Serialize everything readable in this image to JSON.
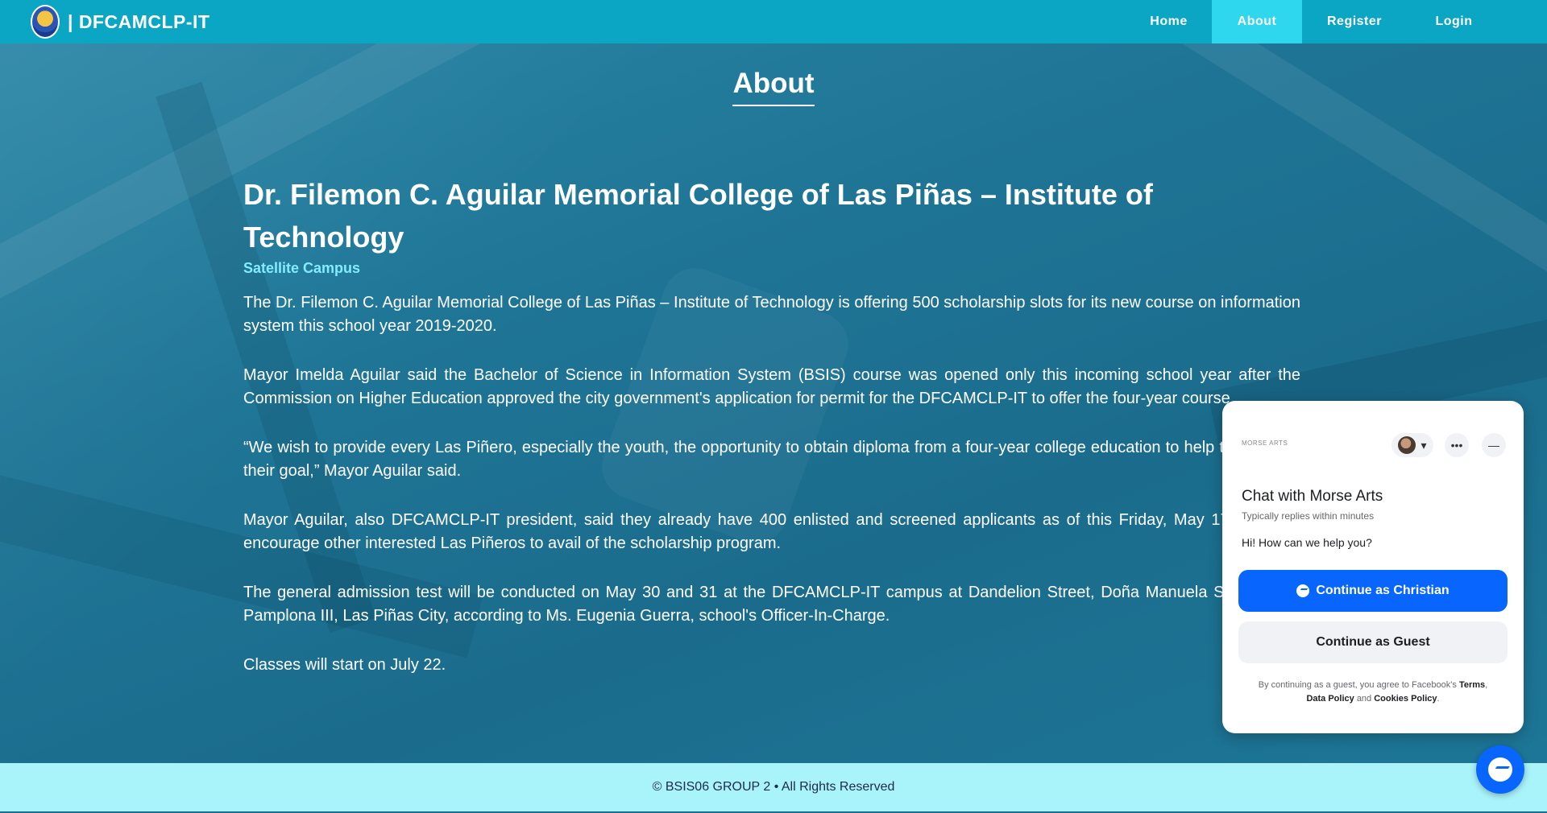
{
  "header": {
    "brand": "| DFCAMCLP-IT",
    "nav": [
      "Home",
      "About",
      "Register",
      "Login"
    ],
    "active": "About"
  },
  "page": {
    "title": "About",
    "college": "Dr. Filemon C. Aguilar Memorial College of Las Piñas – Institute of Technology",
    "campus": "Satellite Campus",
    "paragraphs": [
      "The Dr. Filemon C. Aguilar Memorial College of Las Piñas – Institute of Technology is offering 500 scholarship slots for its new course on information system this school year 2019-2020.",
      "Mayor Imelda Aguilar said the Bachelor of Science in Information System (BSIS) course was opened only this incoming school year after the Commission on Higher Education approved the city government's application for permit for the DFCAMCLP-IT to offer the four-year course.",
      "“We wish to provide every Las Piñero, especially the youth, the opportunity to obtain diploma from a four-year college education to help them reach their goal,” Mayor Aguilar said.",
      "Mayor Aguilar, also DFCAMCLP-IT president, said they already have 400 enlisted and screened applicants as of this Friday, May 17, and she encourage other interested Las Piñeros to avail of the scholarship program.",
      "The general admission test will be conducted on May 30 and 31 at the DFCAMCLP-IT campus at Dandelion Street, Doña Manuela Subdivision, Pamplona III, Las Piñas City, according to Ms. Eugenia Guerra, school's Officer-In-Charge.",
      "Classes will start on July 22."
    ]
  },
  "footer": {
    "text": "© BSIS06 GROUP 2 • All Rights Reserved"
  },
  "chat": {
    "brand": "MORSE ARTS",
    "title": "Chat with Morse Arts",
    "subtitle": "Typically replies within minutes",
    "greeting": "Hi! How can we help you?",
    "primary_button": "Continue as Christian",
    "guest_button": "Continue as Guest",
    "legal_prefix": "By continuing as a guest, you agree to Facebook's",
    "terms": "Terms",
    "data_policy": "Data Policy",
    "and": "and",
    "cookies_policy": "Cookies Policy",
    "more_icon": "•••",
    "minimize_icon": "—",
    "caret_icon": "▾"
  },
  "colors": {
    "header": "#0aa6c4",
    "active_tab": "#2ed6ee",
    "campus": "#83ecff",
    "footer": "#a9f3fb",
    "messenger": "#0866ff"
  },
  "icons": [
    "college-logo",
    "messenger-icon",
    "avatar",
    "more-icon",
    "minimize-icon"
  ]
}
